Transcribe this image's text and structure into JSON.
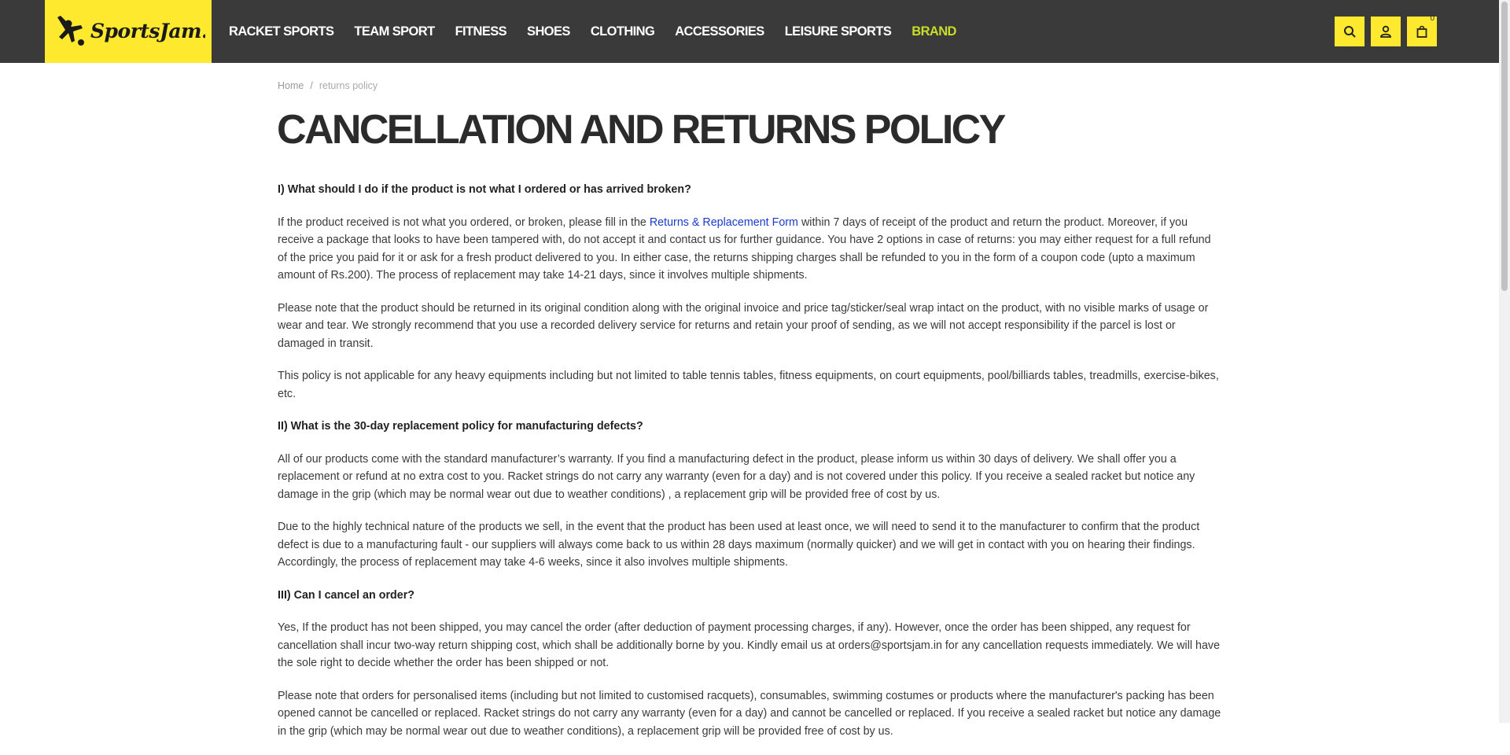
{
  "header": {
    "logo_alt": "SportsJam.in",
    "nav": [
      {
        "label": "RACKET SPORTS"
      },
      {
        "label": "TEAM SPORT"
      },
      {
        "label": "FITNESS"
      },
      {
        "label": "SHOES"
      },
      {
        "label": "CLOTHING"
      },
      {
        "label": "ACCESSORIES"
      },
      {
        "label": "LEISURE SPORTS"
      },
      {
        "label": "BRAND"
      }
    ],
    "cart_count": "0",
    "colors": {
      "accent": "#ffe92f",
      "brand_link": "#c8dc28",
      "bar": "#3a3a3a"
    }
  },
  "breadcrumb": {
    "home": "Home",
    "sep": "/",
    "current": "returns policy"
  },
  "page": {
    "title": "CANCELLATION AND RETURNS POLICY",
    "q1": "I) What should I do if the product is not what I ordered or has arrived broken?",
    "p1a": "If the product received is not what you ordered, or broken, please fill in the ",
    "p1_link": "Returns & Replacement Form",
    "p1b": " within 7 days of receipt of the product and return the product. Moreover, if you receive a package that looks to have been tampered with, do not accept it and contact us for further guidance. You have 2 options in case of returns: you may either request for a full refund of the price you paid for it or ask for a fresh product delivered to you. In either case, the returns shipping charges shall be refunded to you in the form of a coupon code (upto a maximum amount of Rs.200). The process of replacement may take 14-21 days, since it involves multiple shipments.",
    "p2": "Please note that the product should be returned in its original condition along with the original invoice and price tag/sticker/seal wrap intact on the product, with no visible marks of usage or wear and tear. We strongly recommend that you use a recorded delivery service for returns and retain your proof of sending, as we will not accept responsibility if the parcel is lost or damaged in transit.",
    "p3": "This policy is not applicable for any heavy equipments including but not limited to table tennis tables, fitness equipments, on court equipments, pool/billiards tables, treadmills, exercise-bikes, etc.",
    "q2": "II) What is the 30-day replacement policy for manufacturing defects?",
    "p4": "All of our products come with the standard manufacturer’s warranty. If you find a manufacturing defect in the product, please inform us within 30 days of delivery. We shall offer you a replacement or refund at no extra cost to you. Racket strings do not carry any warranty (even for a day) and is not covered under this policy. If you receive a sealed racket but notice any damage in the grip (which may be normal wear out due to weather conditions) , a replacement grip will be provided free of cost by us.",
    "p5": "Due to the highly technical nature of the products we sell, in the event that the product has been used at least once, we will need to send it to the manufacturer to confirm that the product defect is due to a manufacturing fault - our suppliers will always come back to us within 28 days maximum (normally quicker) and we will get in contact with you on hearing their findings. Accordingly, the process of replacement may take 4-6 weeks, since it also involves multiple shipments.",
    "q3": "III) Can I cancel an order?",
    "p6": "Yes, If the product has not been shipped, you may cancel the order (after deduction of payment processing charges, if any). However, once the order has been shipped, any request for cancellation shall incur two-way return shipping cost, which shall be additionally borne by you. Kindly email us at orders@sportsjam.in for any cancellation requests immediately. We will have the sole right to decide whether the order has been shipped or not.",
    "p7": "Please note that orders for personalised items (including but not limited to customised racquets), consumables, swimming costumes or products where the manufacturer's packing has been opened cannot be cancelled or replaced. Racket strings do not carry any warranty (even for a day) and cannot be cancelled or replaced. If you receive a sealed racket but notice any damage in the grip (which may be normal wear out due to weather conditions), a replacement grip will be provided free of cost by us."
  }
}
